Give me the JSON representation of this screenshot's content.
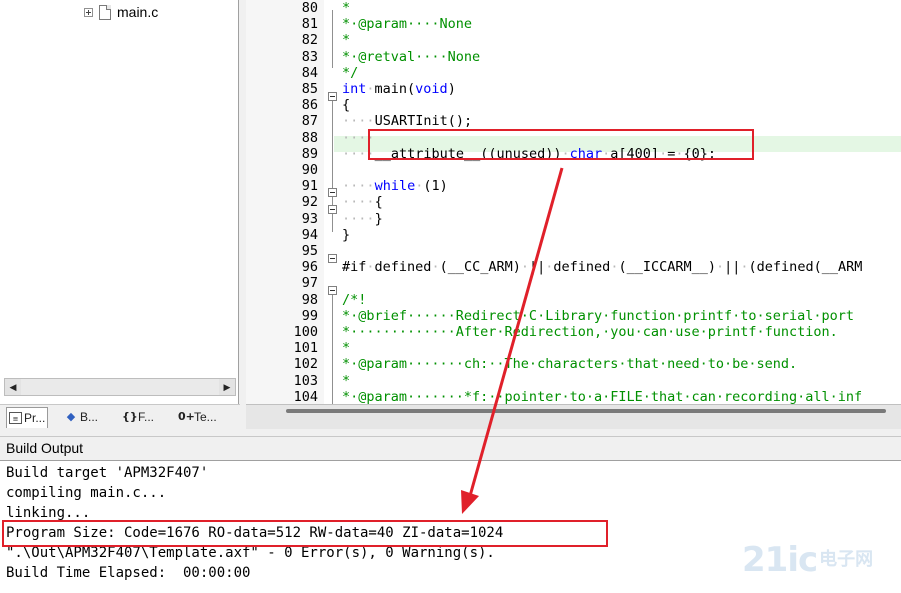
{
  "project_tree": {
    "file_label": "main.c"
  },
  "left_tabs": [
    {
      "label": "Pr...",
      "icon": "project-icon"
    },
    {
      "label": "B...",
      "icon": "books-icon"
    },
    {
      "label": "F...",
      "icon": "functions-icon"
    },
    {
      "label": "Te...",
      "icon": "templates-icon"
    }
  ],
  "editor": {
    "lines": [
      {
        "n": "80",
        "text": "*"
      },
      {
        "n": "81",
        "text": "*·@param····None"
      },
      {
        "n": "82",
        "text": "*"
      },
      {
        "n": "83",
        "text": "*·@retval····None"
      },
      {
        "n": "84",
        "text": "*/"
      },
      {
        "n": "85",
        "text": "int·main(void)"
      },
      {
        "n": "86",
        "text": "{"
      },
      {
        "n": "87",
        "text": "····USARTInit();"
      },
      {
        "n": "88",
        "text": "····"
      },
      {
        "n": "89",
        "text": "····__attribute__((unused))·char·a[400]·=·{0};"
      },
      {
        "n": "90",
        "text": ""
      },
      {
        "n": "91",
        "text": "····while·(1)"
      },
      {
        "n": "92",
        "text": "····{"
      },
      {
        "n": "93",
        "text": "····}"
      },
      {
        "n": "94",
        "text": "}"
      },
      {
        "n": "95",
        "text": ""
      },
      {
        "n": "96",
        "text": "#if·defined·(__CC_ARM)·||·defined·(__ICCARM__)·||·(defined(__ARM"
      },
      {
        "n": "97",
        "text": ""
      },
      {
        "n": "98",
        "text": "/*!"
      },
      {
        "n": "99",
        "text": "*·@brief······Redirect·C·Library·function·printf·to·serial·port"
      },
      {
        "n": "100",
        "text": "*·············After·Redirection,·you·can·use·printf·function."
      },
      {
        "n": "101",
        "text": "*"
      },
      {
        "n": "102",
        "text": "*·@param·······ch:··The·characters·that·need·to·be·send."
      },
      {
        "n": "103",
        "text": "*"
      },
      {
        "n": "104",
        "text": "*·@param·······*f:··pointer·to·a·FILE·that·can·recording·all·inf"
      }
    ]
  },
  "build_output": {
    "title": "Build Output",
    "lines": [
      "Build target 'APM32F407'",
      "compiling main.c...",
      "linking...",
      "Program Size: Code=1676 RO-data=512 RW-data=40 ZI-data=1024",
      "\".\\Out\\APM32F407\\Template.axf\" - 0 Error(s), 0 Warning(s).",
      "Build Time Elapsed:  00:00:00"
    ]
  },
  "watermark": {
    "number": "21ic",
    "cn_line1": "电子网"
  },
  "colors": {
    "annotation_red": "#e0202a",
    "keyword_blue": "#0000ff",
    "comment_green": "#009000"
  }
}
